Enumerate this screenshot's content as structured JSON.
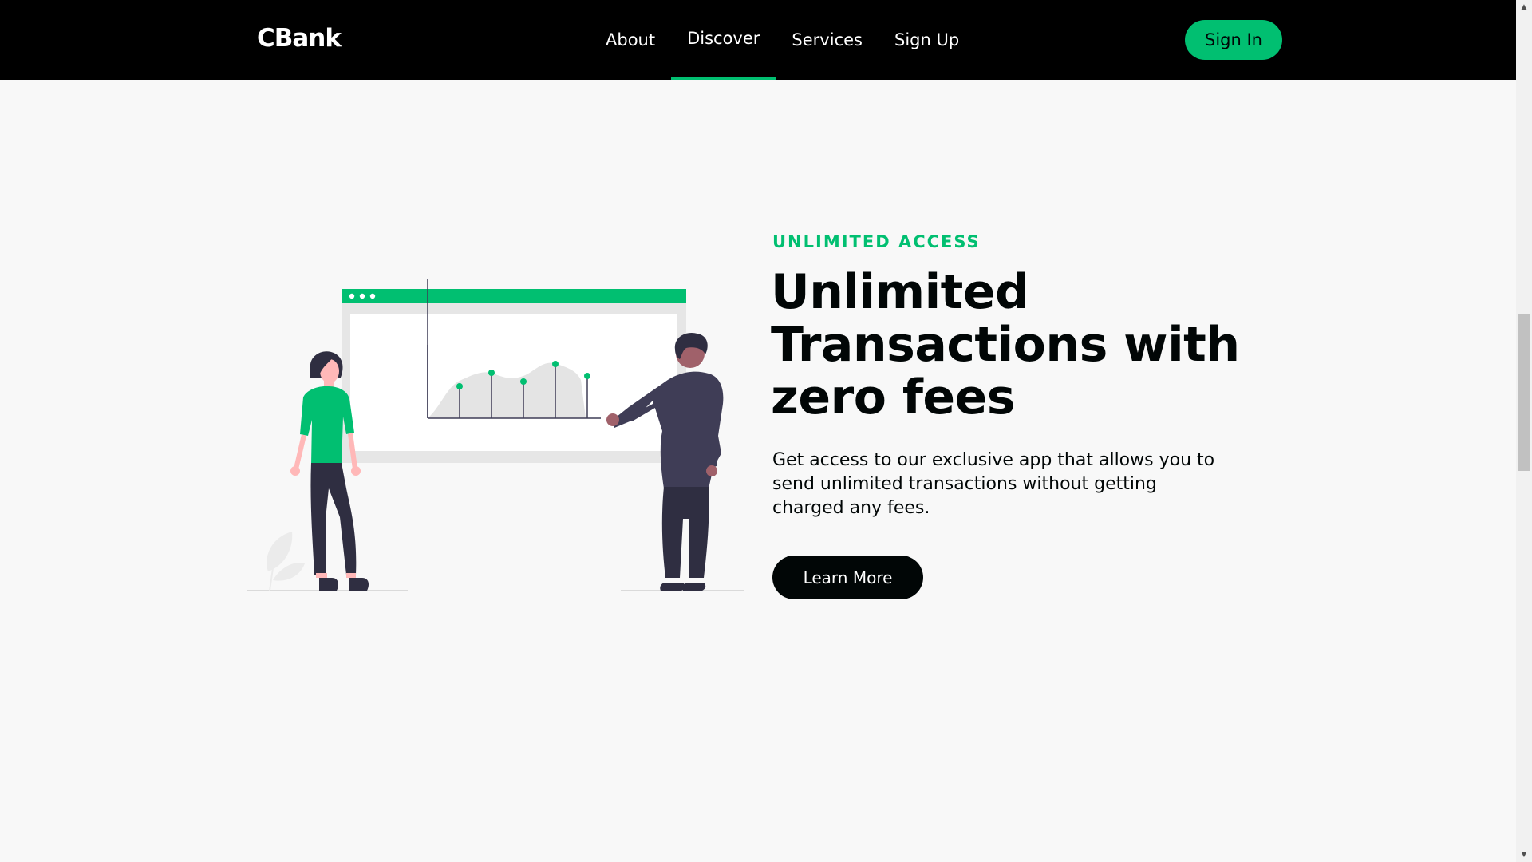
{
  "nav": {
    "brand": "CBank",
    "links": [
      {
        "label": "About"
      },
      {
        "label": "Discover"
      },
      {
        "label": "Services"
      },
      {
        "label": "Sign Up"
      }
    ],
    "active_link": "Discover",
    "signin_label": "Sign In"
  },
  "hero": {
    "topline": "UNLIMITED ACCESS",
    "heading": "Unlimited Transactions with zero fees",
    "subtitle": "Get access to our exclusive app that allows you to send unlimited transactions without getting charged any fees.",
    "button_label": "Learn More"
  },
  "colors": {
    "accent": "#01bf71",
    "dark": "#010606",
    "nav_bg": "#000000",
    "page_bg": "#f8f8f8"
  },
  "icons": {
    "scroll_up": "up-arrow-icon",
    "scroll_down": "down-arrow-icon"
  }
}
